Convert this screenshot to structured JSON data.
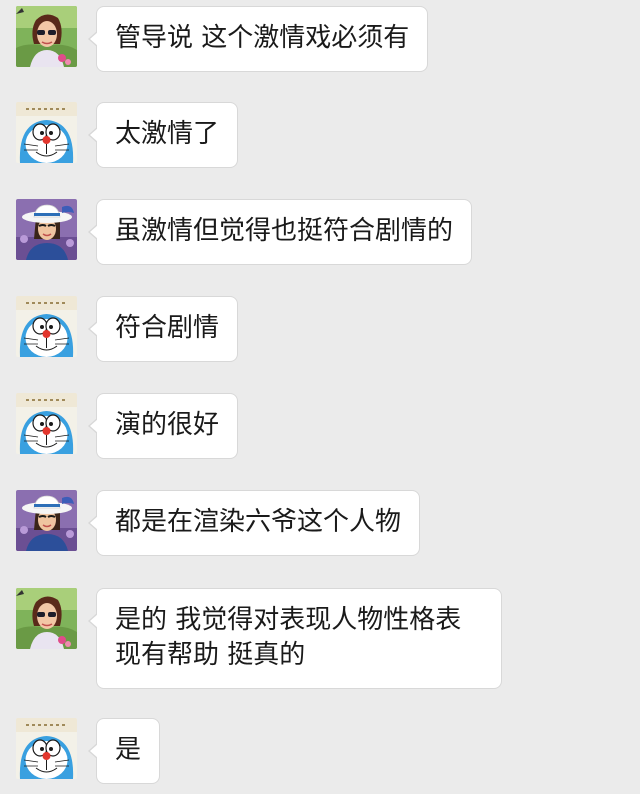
{
  "conversation": {
    "messages": [
      {
        "sender_avatar": "woman-sunglasses-avatar",
        "text": "管导说 这个激情戏必须有"
      },
      {
        "sender_avatar": "doraemon-avatar",
        "text": "太激情了"
      },
      {
        "sender_avatar": "woman-hat-avatar",
        "text": "虽激情但觉得也挺符合剧情的"
      },
      {
        "sender_avatar": "doraemon-avatar",
        "text": "符合剧情"
      },
      {
        "sender_avatar": "doraemon-avatar",
        "text": "演的很好"
      },
      {
        "sender_avatar": "woman-hat-avatar",
        "text": "都是在渲染六爷这个人物"
      },
      {
        "sender_avatar": "woman-sunglasses-avatar",
        "text": "是的 我觉得对表现人物性格表现有帮助 挺真的"
      },
      {
        "sender_avatar": "doraemon-avatar",
        "text": "是"
      }
    ]
  },
  "colors": {
    "background": "#ebebeb",
    "bubble": "#ffffff",
    "bubble_border": "#d8d8d8",
    "text": "#1a1a1a"
  }
}
